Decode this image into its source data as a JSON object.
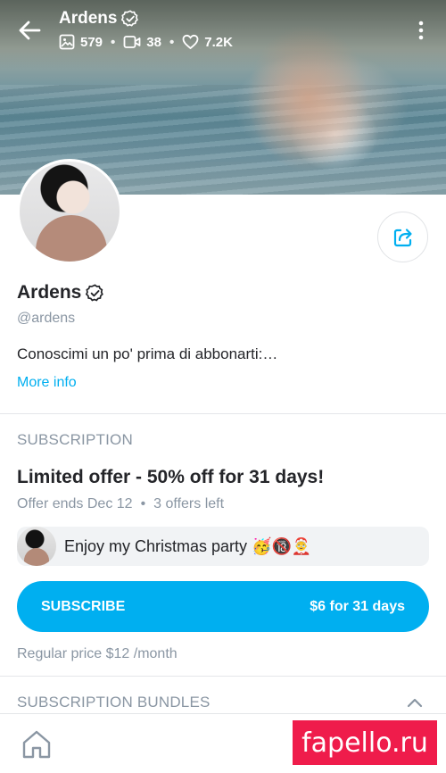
{
  "header": {
    "name": "Ardens",
    "stats": {
      "photos": "579",
      "videos": "38",
      "likes": "7.2K"
    },
    "icons": [
      "back-arrow-icon",
      "verified-badge-icon",
      "image-icon",
      "video-icon",
      "heart-icon",
      "more-vertical-icon"
    ]
  },
  "profile": {
    "name": "Ardens",
    "handle": "@ardens",
    "bio": "Conoscimi un po' prima di abbonarti:…",
    "more_info": "More info"
  },
  "subscription": {
    "section_label": "SUBSCRIPTION",
    "offer_title": "Limited offer - 50% off for 31 days!",
    "offer_ends": "Offer ends Dec 12",
    "offers_left": "3 offers left",
    "promo_message": "Enjoy my Christmas party 🥳🔞🤶",
    "subscribe_label": "SUBSCRIBE",
    "subscribe_price": "$6 for 31 days",
    "regular_price": "Regular price $12 /month"
  },
  "bundles": {
    "section_label": "SUBSCRIPTION BUNDLES"
  },
  "nav": {
    "home_icon": "home-icon"
  },
  "watermark": {
    "text": "fapello.ru"
  },
  "colors": {
    "accent": "#00aff0",
    "text_primary": "#242529",
    "text_secondary": "#8a96a3",
    "watermark_bg": "#ef1c4b"
  }
}
